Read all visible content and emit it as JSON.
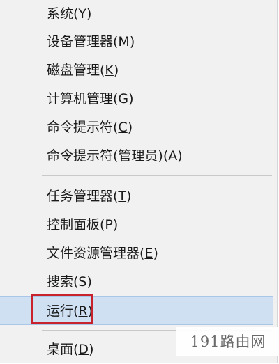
{
  "menu": {
    "items": [
      {
        "label": "系统(",
        "key": "Y",
        "suffix": ")"
      },
      {
        "label": "设备管理器(",
        "key": "M",
        "suffix": ")"
      },
      {
        "label": "磁盘管理(",
        "key": "K",
        "suffix": ")"
      },
      {
        "label": "计算机管理(",
        "key": "G",
        "suffix": ")"
      },
      {
        "label": "命令提示符(",
        "key": "C",
        "suffix": ")"
      },
      {
        "label": "命令提示符(管理员)(",
        "key": "A",
        "suffix": ")"
      },
      {
        "label": "任务管理器(",
        "key": "T",
        "suffix": ")"
      },
      {
        "label": "控制面板(",
        "key": "P",
        "suffix": ")"
      },
      {
        "label": "文件资源管理器(",
        "key": "E",
        "suffix": ")"
      },
      {
        "label": "搜索(",
        "key": "S",
        "suffix": ")"
      },
      {
        "label": "运行(",
        "key": "R",
        "suffix": ")"
      },
      {
        "label": "桌面(",
        "key": "D",
        "suffix": ")"
      }
    ],
    "highlight_color": "#cfe0f3",
    "annotation_color": "#c8232c"
  },
  "watermark": {
    "text": "191路由网"
  }
}
